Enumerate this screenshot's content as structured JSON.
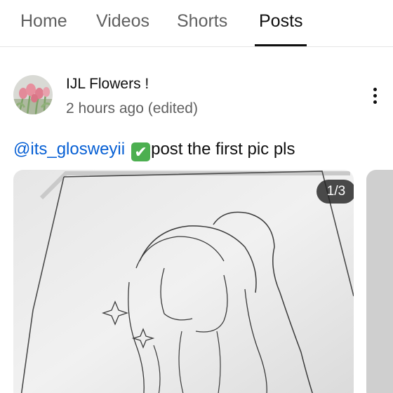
{
  "tabs": [
    {
      "label": "Home",
      "active": false
    },
    {
      "label": "Videos",
      "active": false
    },
    {
      "label": "Shorts",
      "active": false
    },
    {
      "label": "Posts",
      "active": true
    }
  ],
  "post": {
    "channel_name": "IJL Flowers !",
    "time": "2 hours ago (edited)",
    "mention": "@its_glosweyii",
    "emoji": "✔",
    "text": "post the first pic pls",
    "image_counter": "1/3",
    "menu_icon": "more-vertical-icon"
  },
  "colors": {
    "mention": "#065fd4",
    "active_tab": "#0f0f0f",
    "inactive_tab": "#606060",
    "check_emoji": "#4caf50"
  }
}
